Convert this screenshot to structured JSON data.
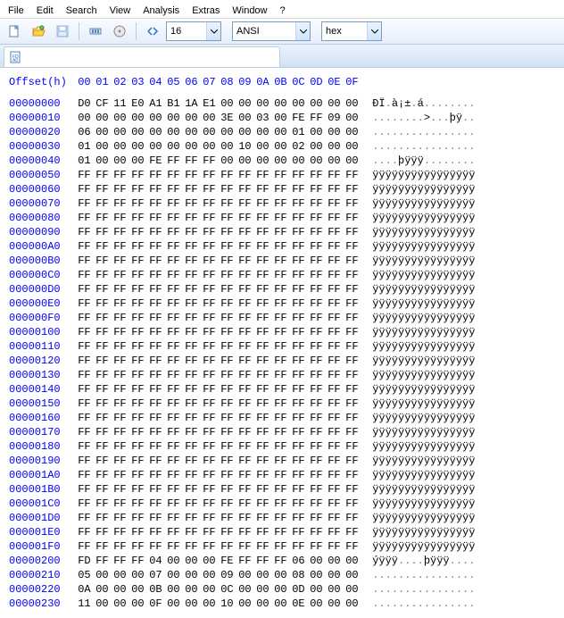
{
  "menubar": [
    "File",
    "Edit",
    "Search",
    "View",
    "Analysis",
    "Extras",
    "Window",
    "?"
  ],
  "toolbar": {
    "bytes_per_row": "16",
    "encoding": "ANSI",
    "datatype": "hex"
  },
  "offset_header": {
    "label": "Offset(h)",
    "cols": [
      "00",
      "01",
      "02",
      "03",
      "04",
      "05",
      "06",
      "07",
      "08",
      "09",
      "0A",
      "0B",
      "0C",
      "0D",
      "0E",
      "0F"
    ]
  },
  "rows": [
    {
      "addr": "00000000",
      "hex": [
        "D0",
        "CF",
        "11",
        "E0",
        "A1",
        "B1",
        "1A",
        "E1",
        "00",
        "00",
        "00",
        "00",
        "00",
        "00",
        "00",
        "00"
      ],
      "ascii": "ÐÏ.à¡±.á........"
    },
    {
      "addr": "00000010",
      "hex": [
        "00",
        "00",
        "00",
        "00",
        "00",
        "00",
        "00",
        "00",
        "3E",
        "00",
        "03",
        "00",
        "FE",
        "FF",
        "09",
        "00"
      ],
      "ascii": "........>...þÿ.."
    },
    {
      "addr": "00000020",
      "hex": [
        "06",
        "00",
        "00",
        "00",
        "00",
        "00",
        "00",
        "00",
        "00",
        "00",
        "00",
        "00",
        "01",
        "00",
        "00",
        "00"
      ],
      "ascii": "................"
    },
    {
      "addr": "00000030",
      "hex": [
        "01",
        "00",
        "00",
        "00",
        "00",
        "00",
        "00",
        "00",
        "00",
        "10",
        "00",
        "00",
        "02",
        "00",
        "00",
        "00"
      ],
      "ascii": "................"
    },
    {
      "addr": "00000040",
      "hex": [
        "01",
        "00",
        "00",
        "00",
        "FE",
        "FF",
        "FF",
        "FF",
        "00",
        "00",
        "00",
        "00",
        "00",
        "00",
        "00",
        "00"
      ],
      "ascii": "....þÿÿÿ........"
    },
    {
      "addr": "00000050",
      "hex": [
        "FF",
        "FF",
        "FF",
        "FF",
        "FF",
        "FF",
        "FF",
        "FF",
        "FF",
        "FF",
        "FF",
        "FF",
        "FF",
        "FF",
        "FF",
        "FF"
      ],
      "ascii": "ÿÿÿÿÿÿÿÿÿÿÿÿÿÿÿÿ"
    },
    {
      "addr": "00000060",
      "hex": [
        "FF",
        "FF",
        "FF",
        "FF",
        "FF",
        "FF",
        "FF",
        "FF",
        "FF",
        "FF",
        "FF",
        "FF",
        "FF",
        "FF",
        "FF",
        "FF"
      ],
      "ascii": "ÿÿÿÿÿÿÿÿÿÿÿÿÿÿÿÿ"
    },
    {
      "addr": "00000070",
      "hex": [
        "FF",
        "FF",
        "FF",
        "FF",
        "FF",
        "FF",
        "FF",
        "FF",
        "FF",
        "FF",
        "FF",
        "FF",
        "FF",
        "FF",
        "FF",
        "FF"
      ],
      "ascii": "ÿÿÿÿÿÿÿÿÿÿÿÿÿÿÿÿ"
    },
    {
      "addr": "00000080",
      "hex": [
        "FF",
        "FF",
        "FF",
        "FF",
        "FF",
        "FF",
        "FF",
        "FF",
        "FF",
        "FF",
        "FF",
        "FF",
        "FF",
        "FF",
        "FF",
        "FF"
      ],
      "ascii": "ÿÿÿÿÿÿÿÿÿÿÿÿÿÿÿÿ"
    },
    {
      "addr": "00000090",
      "hex": [
        "FF",
        "FF",
        "FF",
        "FF",
        "FF",
        "FF",
        "FF",
        "FF",
        "FF",
        "FF",
        "FF",
        "FF",
        "FF",
        "FF",
        "FF",
        "FF"
      ],
      "ascii": "ÿÿÿÿÿÿÿÿÿÿÿÿÿÿÿÿ"
    },
    {
      "addr": "000000A0",
      "hex": [
        "FF",
        "FF",
        "FF",
        "FF",
        "FF",
        "FF",
        "FF",
        "FF",
        "FF",
        "FF",
        "FF",
        "FF",
        "FF",
        "FF",
        "FF",
        "FF"
      ],
      "ascii": "ÿÿÿÿÿÿÿÿÿÿÿÿÿÿÿÿ"
    },
    {
      "addr": "000000B0",
      "hex": [
        "FF",
        "FF",
        "FF",
        "FF",
        "FF",
        "FF",
        "FF",
        "FF",
        "FF",
        "FF",
        "FF",
        "FF",
        "FF",
        "FF",
        "FF",
        "FF"
      ],
      "ascii": "ÿÿÿÿÿÿÿÿÿÿÿÿÿÿÿÿ"
    },
    {
      "addr": "000000C0",
      "hex": [
        "FF",
        "FF",
        "FF",
        "FF",
        "FF",
        "FF",
        "FF",
        "FF",
        "FF",
        "FF",
        "FF",
        "FF",
        "FF",
        "FF",
        "FF",
        "FF"
      ],
      "ascii": "ÿÿÿÿÿÿÿÿÿÿÿÿÿÿÿÿ"
    },
    {
      "addr": "000000D0",
      "hex": [
        "FF",
        "FF",
        "FF",
        "FF",
        "FF",
        "FF",
        "FF",
        "FF",
        "FF",
        "FF",
        "FF",
        "FF",
        "FF",
        "FF",
        "FF",
        "FF"
      ],
      "ascii": "ÿÿÿÿÿÿÿÿÿÿÿÿÿÿÿÿ"
    },
    {
      "addr": "000000E0",
      "hex": [
        "FF",
        "FF",
        "FF",
        "FF",
        "FF",
        "FF",
        "FF",
        "FF",
        "FF",
        "FF",
        "FF",
        "FF",
        "FF",
        "FF",
        "FF",
        "FF"
      ],
      "ascii": "ÿÿÿÿÿÿÿÿÿÿÿÿÿÿÿÿ"
    },
    {
      "addr": "000000F0",
      "hex": [
        "FF",
        "FF",
        "FF",
        "FF",
        "FF",
        "FF",
        "FF",
        "FF",
        "FF",
        "FF",
        "FF",
        "FF",
        "FF",
        "FF",
        "FF",
        "FF"
      ],
      "ascii": "ÿÿÿÿÿÿÿÿÿÿÿÿÿÿÿÿ"
    },
    {
      "addr": "00000100",
      "hex": [
        "FF",
        "FF",
        "FF",
        "FF",
        "FF",
        "FF",
        "FF",
        "FF",
        "FF",
        "FF",
        "FF",
        "FF",
        "FF",
        "FF",
        "FF",
        "FF"
      ],
      "ascii": "ÿÿÿÿÿÿÿÿÿÿÿÿÿÿÿÿ"
    },
    {
      "addr": "00000110",
      "hex": [
        "FF",
        "FF",
        "FF",
        "FF",
        "FF",
        "FF",
        "FF",
        "FF",
        "FF",
        "FF",
        "FF",
        "FF",
        "FF",
        "FF",
        "FF",
        "FF"
      ],
      "ascii": "ÿÿÿÿÿÿÿÿÿÿÿÿÿÿÿÿ"
    },
    {
      "addr": "00000120",
      "hex": [
        "FF",
        "FF",
        "FF",
        "FF",
        "FF",
        "FF",
        "FF",
        "FF",
        "FF",
        "FF",
        "FF",
        "FF",
        "FF",
        "FF",
        "FF",
        "FF"
      ],
      "ascii": "ÿÿÿÿÿÿÿÿÿÿÿÿÿÿÿÿ"
    },
    {
      "addr": "00000130",
      "hex": [
        "FF",
        "FF",
        "FF",
        "FF",
        "FF",
        "FF",
        "FF",
        "FF",
        "FF",
        "FF",
        "FF",
        "FF",
        "FF",
        "FF",
        "FF",
        "FF"
      ],
      "ascii": "ÿÿÿÿÿÿÿÿÿÿÿÿÿÿÿÿ"
    },
    {
      "addr": "00000140",
      "hex": [
        "FF",
        "FF",
        "FF",
        "FF",
        "FF",
        "FF",
        "FF",
        "FF",
        "FF",
        "FF",
        "FF",
        "FF",
        "FF",
        "FF",
        "FF",
        "FF"
      ],
      "ascii": "ÿÿÿÿÿÿÿÿÿÿÿÿÿÿÿÿ"
    },
    {
      "addr": "00000150",
      "hex": [
        "FF",
        "FF",
        "FF",
        "FF",
        "FF",
        "FF",
        "FF",
        "FF",
        "FF",
        "FF",
        "FF",
        "FF",
        "FF",
        "FF",
        "FF",
        "FF"
      ],
      "ascii": "ÿÿÿÿÿÿÿÿÿÿÿÿÿÿÿÿ"
    },
    {
      "addr": "00000160",
      "hex": [
        "FF",
        "FF",
        "FF",
        "FF",
        "FF",
        "FF",
        "FF",
        "FF",
        "FF",
        "FF",
        "FF",
        "FF",
        "FF",
        "FF",
        "FF",
        "FF"
      ],
      "ascii": "ÿÿÿÿÿÿÿÿÿÿÿÿÿÿÿÿ"
    },
    {
      "addr": "00000170",
      "hex": [
        "FF",
        "FF",
        "FF",
        "FF",
        "FF",
        "FF",
        "FF",
        "FF",
        "FF",
        "FF",
        "FF",
        "FF",
        "FF",
        "FF",
        "FF",
        "FF"
      ],
      "ascii": "ÿÿÿÿÿÿÿÿÿÿÿÿÿÿÿÿ"
    },
    {
      "addr": "00000180",
      "hex": [
        "FF",
        "FF",
        "FF",
        "FF",
        "FF",
        "FF",
        "FF",
        "FF",
        "FF",
        "FF",
        "FF",
        "FF",
        "FF",
        "FF",
        "FF",
        "FF"
      ],
      "ascii": "ÿÿÿÿÿÿÿÿÿÿÿÿÿÿÿÿ"
    },
    {
      "addr": "00000190",
      "hex": [
        "FF",
        "FF",
        "FF",
        "FF",
        "FF",
        "FF",
        "FF",
        "FF",
        "FF",
        "FF",
        "FF",
        "FF",
        "FF",
        "FF",
        "FF",
        "FF"
      ],
      "ascii": "ÿÿÿÿÿÿÿÿÿÿÿÿÿÿÿÿ"
    },
    {
      "addr": "000001A0",
      "hex": [
        "FF",
        "FF",
        "FF",
        "FF",
        "FF",
        "FF",
        "FF",
        "FF",
        "FF",
        "FF",
        "FF",
        "FF",
        "FF",
        "FF",
        "FF",
        "FF"
      ],
      "ascii": "ÿÿÿÿÿÿÿÿÿÿÿÿÿÿÿÿ"
    },
    {
      "addr": "000001B0",
      "hex": [
        "FF",
        "FF",
        "FF",
        "FF",
        "FF",
        "FF",
        "FF",
        "FF",
        "FF",
        "FF",
        "FF",
        "FF",
        "FF",
        "FF",
        "FF",
        "FF"
      ],
      "ascii": "ÿÿÿÿÿÿÿÿÿÿÿÿÿÿÿÿ"
    },
    {
      "addr": "000001C0",
      "hex": [
        "FF",
        "FF",
        "FF",
        "FF",
        "FF",
        "FF",
        "FF",
        "FF",
        "FF",
        "FF",
        "FF",
        "FF",
        "FF",
        "FF",
        "FF",
        "FF"
      ],
      "ascii": "ÿÿÿÿÿÿÿÿÿÿÿÿÿÿÿÿ"
    },
    {
      "addr": "000001D0",
      "hex": [
        "FF",
        "FF",
        "FF",
        "FF",
        "FF",
        "FF",
        "FF",
        "FF",
        "FF",
        "FF",
        "FF",
        "FF",
        "FF",
        "FF",
        "FF",
        "FF"
      ],
      "ascii": "ÿÿÿÿÿÿÿÿÿÿÿÿÿÿÿÿ"
    },
    {
      "addr": "000001E0",
      "hex": [
        "FF",
        "FF",
        "FF",
        "FF",
        "FF",
        "FF",
        "FF",
        "FF",
        "FF",
        "FF",
        "FF",
        "FF",
        "FF",
        "FF",
        "FF",
        "FF"
      ],
      "ascii": "ÿÿÿÿÿÿÿÿÿÿÿÿÿÿÿÿ"
    },
    {
      "addr": "000001F0",
      "hex": [
        "FF",
        "FF",
        "FF",
        "FF",
        "FF",
        "FF",
        "FF",
        "FF",
        "FF",
        "FF",
        "FF",
        "FF",
        "FF",
        "FF",
        "FF",
        "FF"
      ],
      "ascii": "ÿÿÿÿÿÿÿÿÿÿÿÿÿÿÿÿ"
    },
    {
      "addr": "00000200",
      "hex": [
        "FD",
        "FF",
        "FF",
        "FF",
        "04",
        "00",
        "00",
        "00",
        "FE",
        "FF",
        "FF",
        "FF",
        "06",
        "00",
        "00",
        "00"
      ],
      "ascii": "ýÿÿÿ....þÿÿÿ...."
    },
    {
      "addr": "00000210",
      "hex": [
        "05",
        "00",
        "00",
        "00",
        "07",
        "00",
        "00",
        "00",
        "09",
        "00",
        "00",
        "00",
        "08",
        "00",
        "00",
        "00"
      ],
      "ascii": "................"
    },
    {
      "addr": "00000220",
      "hex": [
        "0A",
        "00",
        "00",
        "00",
        "0B",
        "00",
        "00",
        "00",
        "0C",
        "00",
        "00",
        "00",
        "0D",
        "00",
        "00",
        "00"
      ],
      "ascii": "................"
    },
    {
      "addr": "00000230",
      "hex": [
        "11",
        "00",
        "00",
        "00",
        "0F",
        "00",
        "00",
        "00",
        "10",
        "00",
        "00",
        "00",
        "0E",
        "00",
        "00",
        "00"
      ],
      "ascii": "................"
    }
  ]
}
